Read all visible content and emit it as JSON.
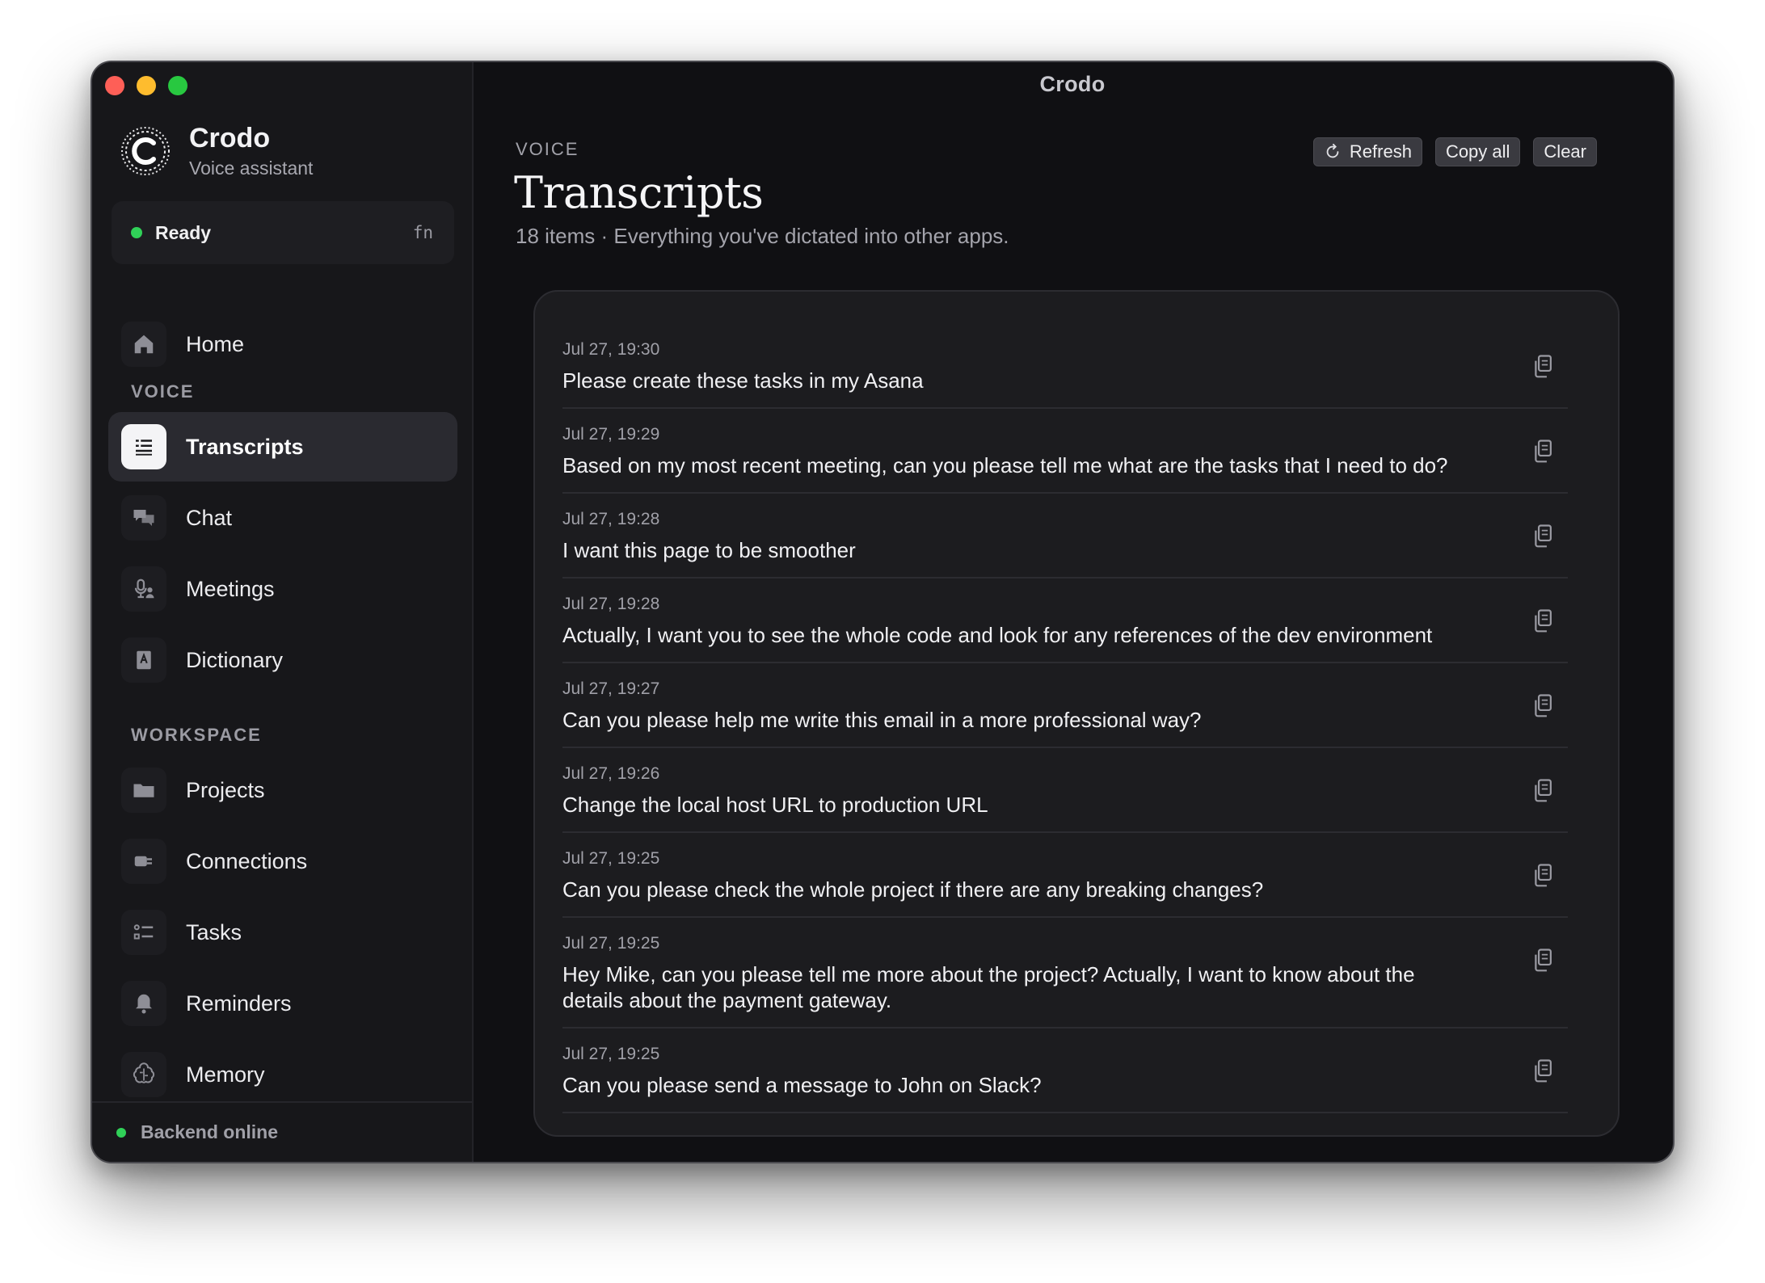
{
  "window": {
    "title": "Crodo"
  },
  "brand": {
    "name": "Crodo",
    "subtitle": "Voice assistant"
  },
  "status": {
    "label": "Ready",
    "hotkey": "fn",
    "color": "#30d158"
  },
  "sidebar": {
    "home": {
      "label": "Home",
      "icon": "home-icon"
    },
    "voice_section": "VOICE",
    "voice_items": [
      {
        "label": "Transcripts",
        "icon": "transcripts-icon",
        "active": true
      },
      {
        "label": "Chat",
        "icon": "chat-bubbles-icon"
      },
      {
        "label": "Meetings",
        "icon": "microphone-person-icon"
      },
      {
        "label": "Dictionary",
        "icon": "dictionary-book-icon"
      }
    ],
    "workspace_section": "WORKSPACE",
    "workspace_items": [
      {
        "label": "Projects",
        "icon": "folder-icon"
      },
      {
        "label": "Connections",
        "icon": "plug-icon"
      },
      {
        "label": "Tasks",
        "icon": "task-list-icon"
      },
      {
        "label": "Reminders",
        "icon": "bell-icon"
      },
      {
        "label": "Memory",
        "icon": "brain-icon"
      }
    ],
    "footer": "Backend online"
  },
  "main": {
    "eyebrow": "VOICE",
    "title": "Transcripts",
    "subtitle": "18 items · Everything you've dictated into other apps.",
    "toolbar": {
      "refresh": "Refresh",
      "copy_all": "Copy all",
      "clear": "Clear"
    }
  },
  "transcripts": [
    {
      "time": "Jul 27, 19:30",
      "text": "Please create these tasks in my Asana"
    },
    {
      "time": "Jul 27, 19:29",
      "text": "Based on my most recent meeting, can you please tell me what are the tasks that I need to do?"
    },
    {
      "time": "Jul 27, 19:28",
      "text": "I want this page to be smoother"
    },
    {
      "time": "Jul 27, 19:28",
      "text": "Actually, I want you to see the whole code and look for any references of the dev environment"
    },
    {
      "time": "Jul 27, 19:27",
      "text": "Can you please help me write this email in a more professional way?"
    },
    {
      "time": "Jul 27, 19:26",
      "text": "Change the local host URL to production URL"
    },
    {
      "time": "Jul 27, 19:25",
      "text": "Can you please check the whole project if there are any breaking changes?"
    },
    {
      "time": "Jul 27, 19:25",
      "text": "Hey Mike, can you please tell me more about the project? Actually, I want to know about the details about the payment gateway."
    },
    {
      "time": "Jul 27, 19:25",
      "text": "Can you please send a message to John on Slack?"
    }
  ]
}
